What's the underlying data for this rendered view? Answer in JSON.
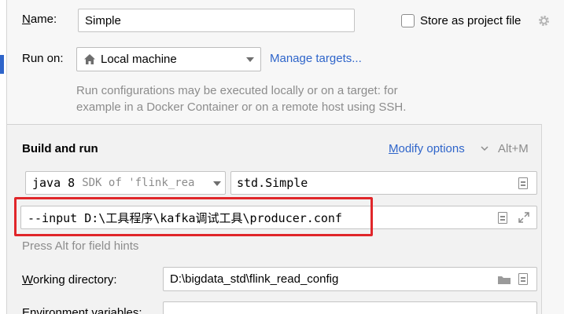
{
  "form": {
    "name_label": "Name:",
    "name_value": "Simple",
    "store_label": "Store as project file",
    "run_on_label": "Run on:",
    "run_on_value": "Local machine",
    "manage_targets": "Manage targets...",
    "run_hint_line1": "Run configurations may be executed locally or on a target: for",
    "run_hint_line2": "example in a Docker Container or on a remote host using SSH."
  },
  "build": {
    "title": "Build and run",
    "modify_options": "Modify options",
    "modify_shortcut": "Alt+M",
    "jdk_value": "java 8",
    "jdk_sdk": "SDK of 'flink_rea",
    "main_class": "std.Simple",
    "program_args": "--input D:\\工具程序\\kafka调试工具\\producer.conf",
    "field_hint": "Press Alt for field hints"
  },
  "working_dir": {
    "label": "Working directory:",
    "value": "D:\\bigdata_std\\flink_read_config"
  },
  "env": {
    "label": "Environment variables:"
  },
  "colors": {
    "accent": "#2f65ca",
    "highlight": "#e0262a"
  }
}
